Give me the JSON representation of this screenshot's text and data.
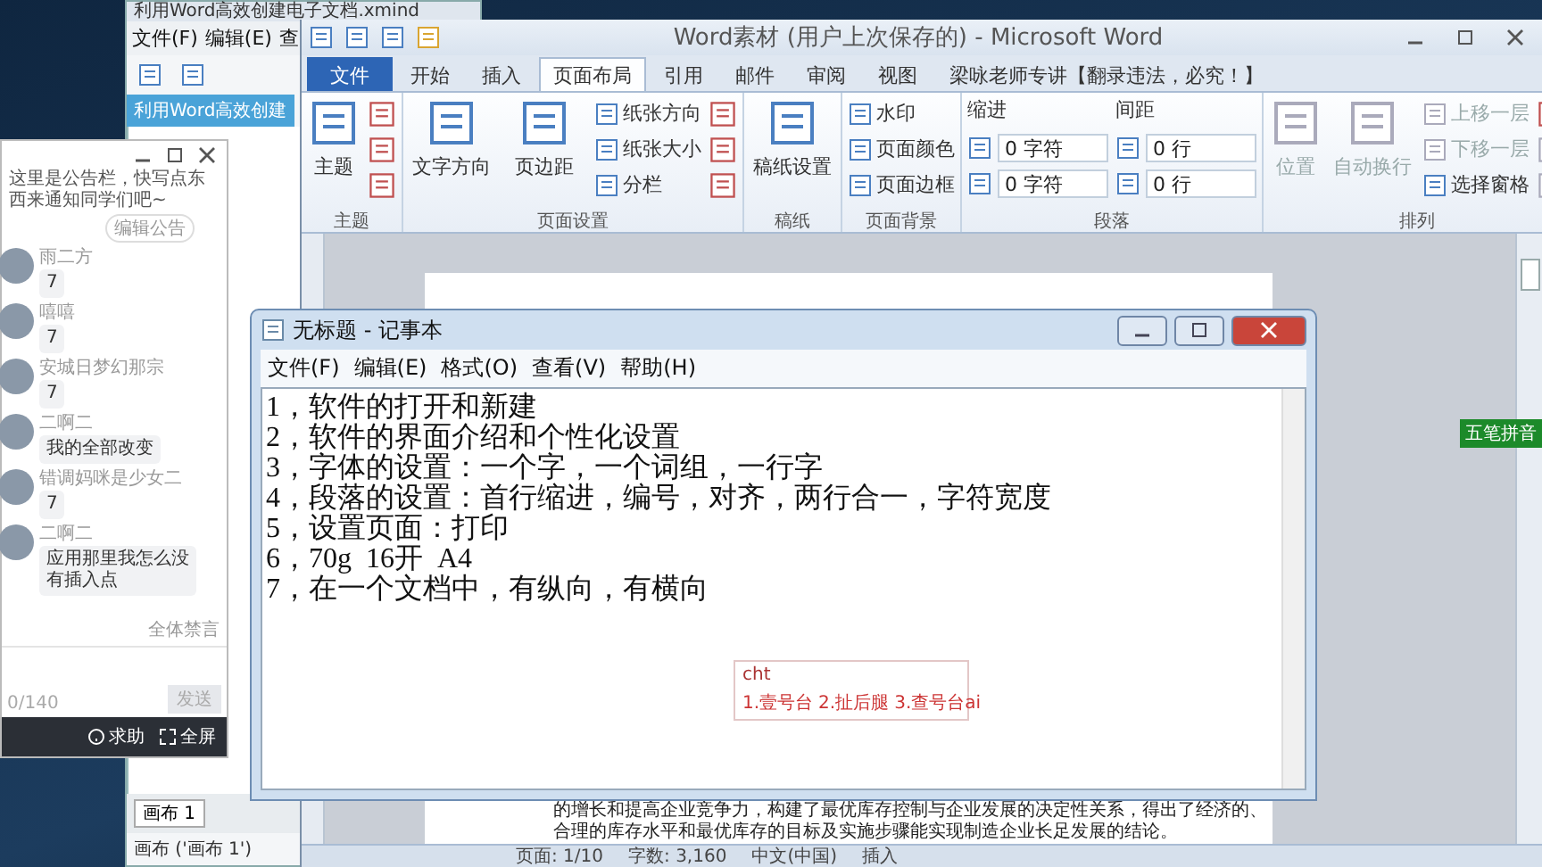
{
  "xmind": {
    "title": "利用Word高效创建电子文档.xmind",
    "menu": [
      "文件(F)",
      "编辑(E)",
      "查"
    ],
    "tab": "利用Word高效创建",
    "sheet_tab": "画布 1",
    "status": "画布 ('画布 1')"
  },
  "word": {
    "title": "Word素材 (用户上次保存的) - Microsoft Word",
    "tabs": [
      {
        "label": "文件",
        "kind": "file",
        "selected": false
      },
      {
        "label": "开始",
        "kind": "tab",
        "selected": false
      },
      {
        "label": "插入",
        "kind": "tab",
        "selected": false
      },
      {
        "label": "页面布局",
        "kind": "tab",
        "selected": true
      },
      {
        "label": "引用",
        "kind": "tab",
        "selected": false
      },
      {
        "label": "邮件",
        "kind": "tab",
        "selected": false
      },
      {
        "label": "审阅",
        "kind": "tab",
        "selected": false
      },
      {
        "label": "视图",
        "kind": "tab",
        "selected": false
      },
      {
        "label": "梁咏老师专讲【翻录违法，必究！】",
        "kind": "tab",
        "selected": false
      }
    ],
    "groups": [
      {
        "label": "主题",
        "columns": [
          [
            {
              "kind": "large",
              "label": "主题",
              "disabled": false
            }
          ],
          [
            {
              "kind": "icon",
              "disabled": false
            },
            {
              "kind": "icon",
              "disabled": false
            },
            {
              "kind": "icon",
              "disabled": false
            }
          ]
        ]
      },
      {
        "label": "页面设置",
        "columns": [
          [
            {
              "kind": "large",
              "label": "文字方向",
              "disabled": false
            }
          ],
          [
            {
              "kind": "large",
              "label": "页边距",
              "disabled": false
            }
          ],
          [
            {
              "kind": "small",
              "label": "纸张方向",
              "disabled": false
            },
            {
              "kind": "small",
              "label": "纸张大小",
              "disabled": false
            },
            {
              "kind": "small",
              "label": "分栏",
              "disabled": false
            }
          ],
          [
            {
              "kind": "icon",
              "disabled": false
            },
            {
              "kind": "icon",
              "disabled": false
            },
            {
              "kind": "icon",
              "disabled": false
            }
          ]
        ]
      },
      {
        "label": "稿纸",
        "columns": [
          [
            {
              "kind": "large",
              "label": "稿纸设置",
              "disabled": false
            }
          ]
        ]
      },
      {
        "label": "页面背景",
        "columns": [
          [
            {
              "kind": "small",
              "label": "水印",
              "disabled": false
            },
            {
              "kind": "small",
              "label": "页面颜色",
              "disabled": false
            },
            {
              "kind": "small",
              "label": "页面边框",
              "disabled": false
            }
          ]
        ]
      },
      {
        "label": "段落",
        "columns": [
          [
            {
              "kind": "heading",
              "label": "缩进",
              "disabled": false
            },
            {
              "kind": "spin",
              "label": "0 字符",
              "disabled": false
            },
            {
              "kind": "spin",
              "label": "0 字符",
              "disabled": false
            }
          ],
          [
            {
              "kind": "heading",
              "label": "间距",
              "disabled": false
            },
            {
              "kind": "spin",
              "label": "0 行",
              "disabled": false
            },
            {
              "kind": "spin",
              "label": "0 行",
              "disabled": false
            }
          ]
        ]
      },
      {
        "label": "排列",
        "columns": [
          [
            {
              "kind": "large",
              "label": "位置",
              "disabled": true
            }
          ],
          [
            {
              "kind": "large",
              "label": "自动换行",
              "disabled": true
            }
          ],
          [
            {
              "kind": "small",
              "label": "上移一层",
              "disabled": true
            },
            {
              "kind": "small",
              "label": "下移一层",
              "disabled": true
            },
            {
              "kind": "small",
              "label": "选择窗格",
              "disabled": false
            }
          ],
          [
            {
              "kind": "icon",
              "disabled": false
            },
            {
              "kind": "icon",
              "disabled": true
            },
            {
              "kind": "icon",
              "disabled": true
            }
          ]
        ]
      }
    ],
    "doc_lines": [
      "的增长和提高企业竞争力，构建了最优库存控制与企业发展的决定性关系，得出了经济的、",
      "合理的库存水平和最优库存的目标及实施步骤能实现制造企业长足发展的结论。"
    ],
    "status": [
      "页面: 1/10",
      "字数: 3,160",
      "中文(中国)",
      "插入"
    ],
    "ime_widget": "五笔拼音"
  },
  "chat": {
    "notice": "这里是公告栏，快写点东西来通知同学们吧~",
    "edit_notice": "编辑公告",
    "messages": [
      {
        "name": "雨二方",
        "text": "7"
      },
      {
        "name": "嘻嘻",
        "text": "7"
      },
      {
        "name": "安城日梦幻那宗",
        "text": "7"
      },
      {
        "name": "二啊二",
        "text": "我的全部改变"
      },
      {
        "name": "错调妈咪是少女二",
        "text": "7"
      },
      {
        "name": "二啊二",
        "text": "应用那里我怎么没有插入点"
      }
    ],
    "mute_all": "全体禁言",
    "counter": "0/140",
    "send": "发送",
    "help": "求助",
    "fullscreen": "全屏"
  },
  "notepad": {
    "title": "无标题 - 记事本",
    "menu": [
      "文件(F)",
      "编辑(E)",
      "格式(O)",
      "查看(V)",
      "帮助(H)"
    ],
    "lines": [
      "1，软件的打开和新建",
      "2，软件的界面介绍和个性化设置",
      "3，字体的设置：一个字，一个词组，一行字",
      "4，段落的设置：首行缩进，编号，对齐，两行合一，字符宽度",
      "5，设置页面：打印",
      "6，70g  16开  A4",
      "7，在一个文档中，有纵向，有横向 "
    ],
    "ime": {
      "input": "cht",
      "candidates": [
        "1.壹号台",
        "2.扯后腿",
        "3.查号台ai"
      ]
    }
  }
}
